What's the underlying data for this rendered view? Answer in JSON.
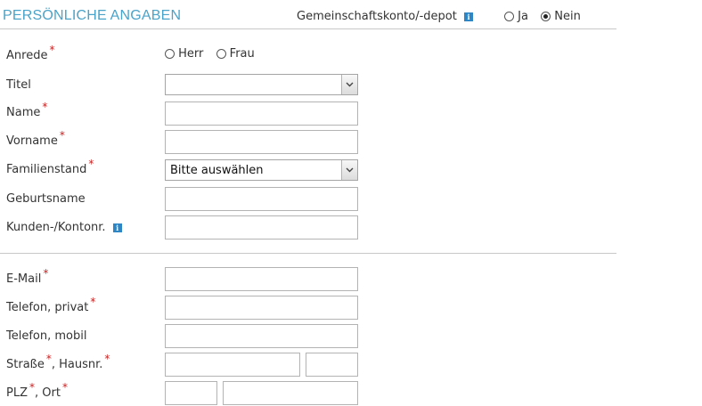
{
  "section": {
    "title": "PERSÖNLICHE ANGABEN"
  },
  "joint_account": {
    "label": "Gemeinschaftskonto/-depot",
    "options": [
      {
        "label": "Ja",
        "checked": false
      },
      {
        "label": "Nein",
        "checked": true
      }
    ]
  },
  "fields": {
    "anrede": {
      "label": "Anrede",
      "required": "*",
      "options": [
        {
          "label": "Herr"
        },
        {
          "label": "Frau"
        }
      ]
    },
    "titel": {
      "label": "Titel",
      "value": ""
    },
    "name": {
      "label": "Name",
      "required": "*",
      "value": ""
    },
    "vorname": {
      "label": "Vorname",
      "required": "*",
      "value": ""
    },
    "familienstand": {
      "label": "Familienstand",
      "required": "*",
      "value": "Bitte auswählen"
    },
    "geburtsname": {
      "label": "Geburtsname",
      "value": ""
    },
    "kundennr": {
      "label": "Kunden-/Kontonr.",
      "value": ""
    },
    "email": {
      "label": "E-Mail",
      "required": "*",
      "value": ""
    },
    "telefon_privat": {
      "label": "Telefon, privat",
      "required": "*",
      "value": ""
    },
    "telefon_mobil": {
      "label": "Telefon, mobil",
      "value": ""
    },
    "strasse": {
      "label": "Straße",
      "sep": ", Hausnr.",
      "required": "*",
      "value": "",
      "hausnr": ""
    },
    "plz": {
      "label": "PLZ",
      "sep": ", Ort",
      "required": "*",
      "value": "",
      "ort": ""
    }
  },
  "icons": {
    "info": "info-icon",
    "chevron": "chevron-down-icon"
  },
  "colors": {
    "title": "#4aa3c8",
    "required": "#cc1f1f",
    "info": "#2f86c5",
    "border": "#b3b3b3"
  }
}
